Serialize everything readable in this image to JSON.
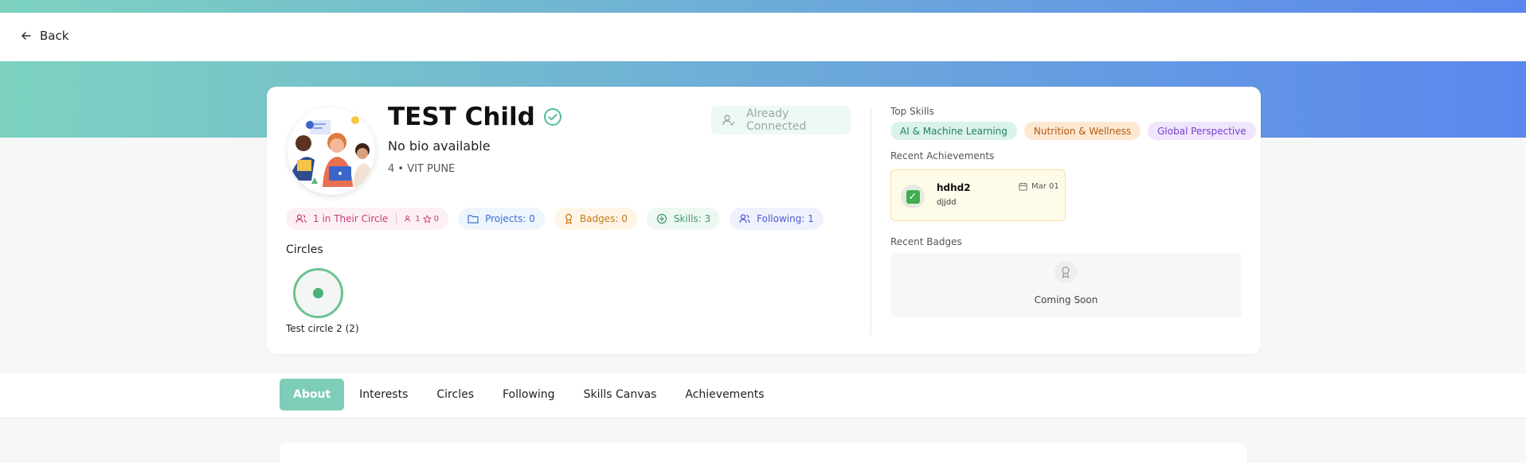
{
  "nav": {
    "back_label": "Back"
  },
  "profile": {
    "name": "TEST Child",
    "bio": "No bio available",
    "meta": "4 • VIT PUNE",
    "connection_label": "Already Connected"
  },
  "stats": {
    "circle_label": "1 in Their Circle",
    "circle_members": "1",
    "circle_stars": "0",
    "projects": "Projects: 0",
    "badges": "Badges: 0",
    "skills": "Skills: 3",
    "following": "Following: 1"
  },
  "circles": {
    "title": "Circles",
    "items": [
      {
        "label": "Test circle 2 (2)"
      }
    ]
  },
  "top_skills": {
    "title": "Top Skills",
    "items": [
      {
        "label": "AI & Machine Learning"
      },
      {
        "label": "Nutrition & Wellness"
      },
      {
        "label": "Global Perspective"
      }
    ]
  },
  "achievements": {
    "title": "Recent Achievements",
    "items": [
      {
        "title": "hdhd2",
        "subtitle": "djjdd",
        "date": "Mar 01"
      }
    ]
  },
  "badges_section": {
    "title": "Recent Badges",
    "empty_label": "Coming Soon"
  },
  "tabs": [
    {
      "label": "About",
      "active": true
    },
    {
      "label": "Interests"
    },
    {
      "label": "Circles"
    },
    {
      "label": "Following"
    },
    {
      "label": "Skills Canvas"
    },
    {
      "label": "Achievements"
    }
  ],
  "colors": {
    "gradient_start": "#7dd3c0",
    "gradient_end": "#5b86ee",
    "active_tab": "#7dcdb8"
  }
}
